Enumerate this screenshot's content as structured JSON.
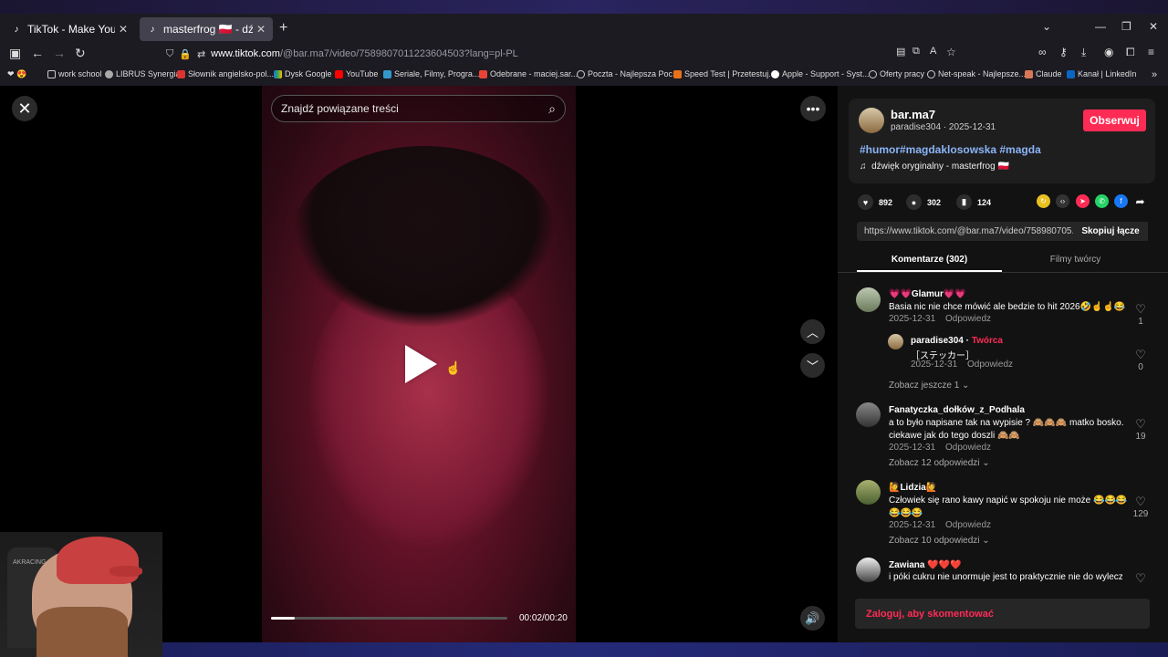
{
  "browser": {
    "tabs": [
      {
        "title": "TikTok - Make Your Day",
        "close": "✕"
      },
      {
        "title": "masterfrog 🇵🇱 - dźwięk orygi",
        "close": "✕"
      }
    ],
    "url_host": "www.tiktok.com",
    "url_path": "/@bar.ma7/video/7589807011223604503?lang=pl-PL",
    "bookmarks": [
      "work school",
      "LIBRUS Synergia",
      "Słownik angielsko-pol...",
      "Dysk Google",
      "YouTube",
      "Seriale, Filmy, Progra...",
      "Odebrane - maciej.sar...",
      "Poczta - Najlepsza Poc...",
      "Speed Test | Przetestuj...",
      "Apple - Support - Syst...",
      "Oferty pracy",
      "Net-speak - Najlepsze...",
      "Claude",
      "Kanał | LinkedIn"
    ]
  },
  "player": {
    "search_placeholder": "Znajdź powiązane treści",
    "time": "00:02/00:20",
    "progress_fraction": 0.1
  },
  "post": {
    "username": "bar.ma7",
    "sub": "paradise304 · 2025-12-31",
    "follow_label": "Obserwuj",
    "tags": "#humor#magdaklosowska #magda",
    "sound": "dźwięk oryginalny - masterfrog 🇵🇱",
    "likes": "892",
    "comments": "302",
    "saves": "124",
    "link": "https://www.tiktok.com/@bar.ma7/video/758980705...",
    "copy_label": "Skopiuj łącze"
  },
  "tabs": {
    "comments": "Komentarze (302)",
    "videos": "Filmy twórcy"
  },
  "comments": [
    {
      "name": "💗💗Glamur💗💗",
      "text": "Basia nic nie chce mówić ale bedzie to hit 2026🤣☝️☝️😂",
      "date": "2025-12-31",
      "reply": "Odpowiedz",
      "likes": "1"
    },
    {
      "name": "paradise304",
      "creator": "Twórca",
      "text": "［ステッカー］",
      "date": "2025-12-31",
      "reply": "Odpowiedz",
      "likes": "0"
    },
    {
      "name": "Fanatyczka_dołków_z_Podhala",
      "text": "a to było napisane tak na wypisie ? 🙈🙈🙈 matko bosko.",
      "text2": "ciekawe jak do tego doszli 🙈🙈",
      "date": "2025-12-31",
      "reply": "Odpowiedz",
      "likes": "19"
    },
    {
      "name": "🙋Lidzia🙋",
      "text": "Człowiek się rano kawy napić w spokoju nie może 😂😂😂",
      "text2": "😂😂😂",
      "date": "2025-12-31",
      "reply": "Odpowiedz",
      "likes": "129"
    },
    {
      "name": "Zawiana ❤️❤️❤️",
      "text": "i póki cukru nie unormuje jest to praktycznie nie do wylecze"
    }
  ],
  "more_replies": [
    "Zobacz jeszcze 1 ⌄",
    "Zobacz 12 odpowiedzi ⌄",
    "Zobacz 10 odpowiedzi ⌄"
  ],
  "login_label": "Zaloguj, aby skomentować",
  "webcam_chair_text": "AKRACING"
}
